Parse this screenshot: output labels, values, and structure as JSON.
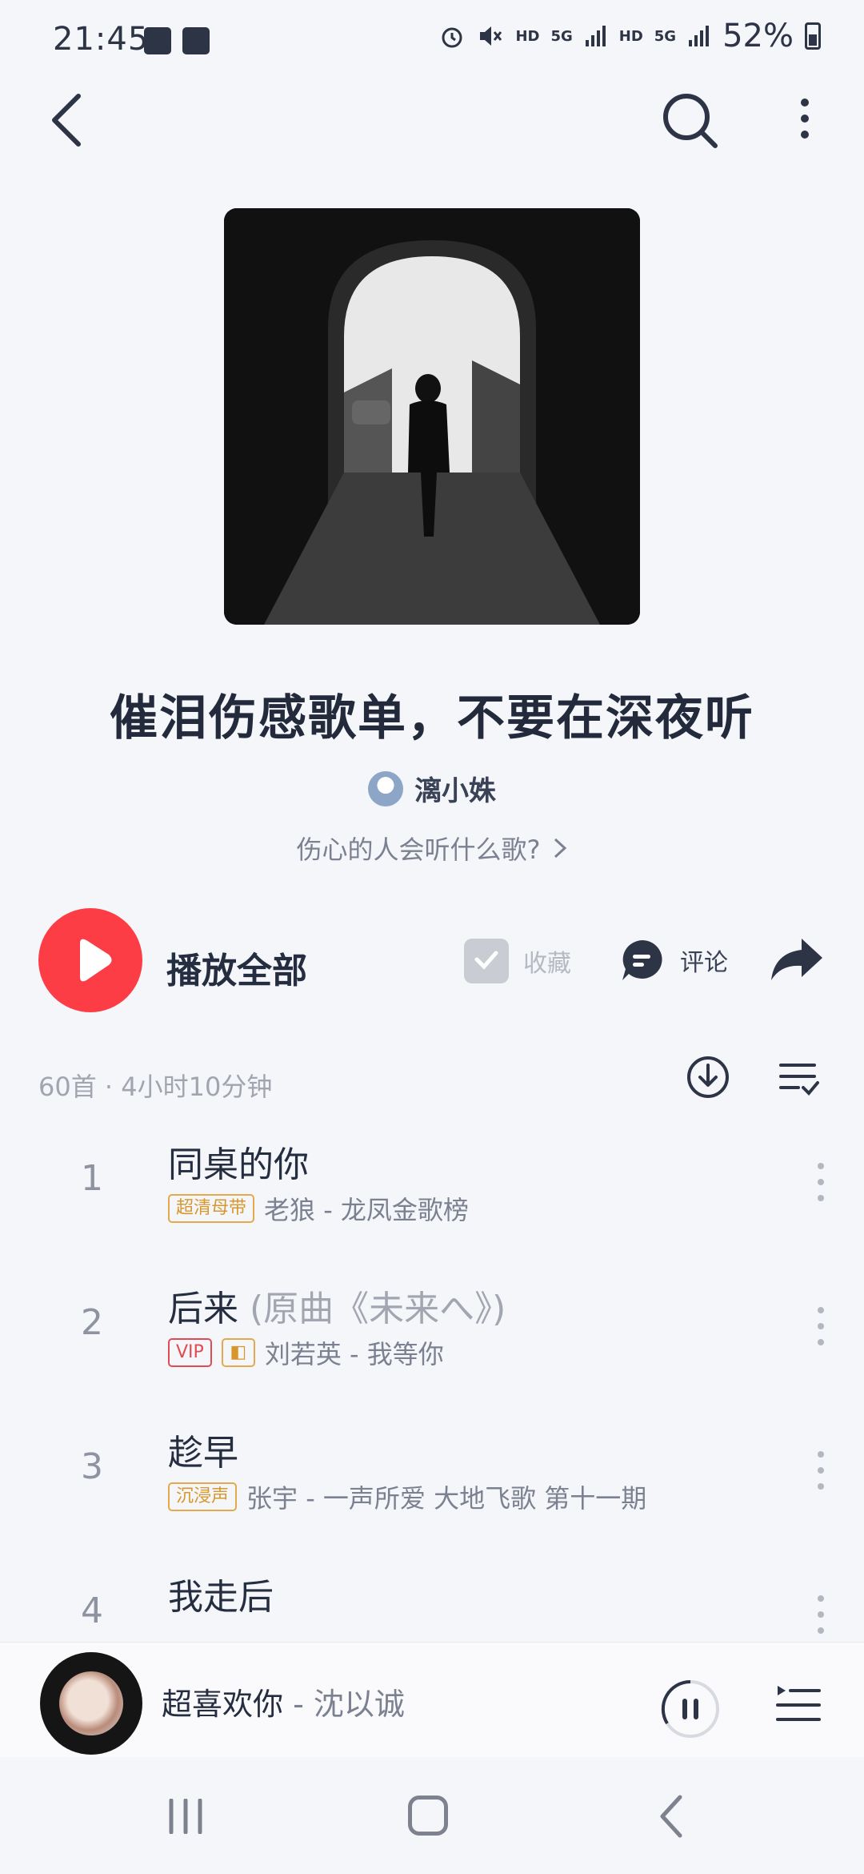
{
  "status_bar": {
    "time": "21:45",
    "network_labels": [
      "HD",
      "5G",
      "HD",
      "5G"
    ],
    "battery": "52%"
  },
  "nav": {
    "back_icon": "chevron-left-icon",
    "search_icon": "search-icon",
    "more_icon": "vertical-dots-icon"
  },
  "playlist": {
    "title": "催泪伤感歌单，不要在深夜听",
    "author": "漓小姝",
    "description": "伤心的人会听什么歌?",
    "meta": "60首 · 4小时10分钟"
  },
  "actions": {
    "play_all": "播放全部",
    "collect": "收藏",
    "comment": "评论"
  },
  "songs": [
    {
      "index": "1",
      "title": "同桌的你",
      "subtitle": "",
      "tags": [
        {
          "text": "超清母带",
          "type": "quality"
        }
      ],
      "artist": "老狼 - 龙凤金歌榜"
    },
    {
      "index": "2",
      "title": "后来",
      "subtitle": " (原曲《未来へ》)",
      "tags": [
        {
          "text": "VIP",
          "type": "vip"
        },
        {
          "text": "◧",
          "type": "dolby"
        }
      ],
      "artist": "刘若英 - 我等你"
    },
    {
      "index": "3",
      "title": "趁早",
      "subtitle": "",
      "tags": [
        {
          "text": "沉浸声",
          "type": "quality"
        }
      ],
      "artist": "张宇 - 一声所爱 大地飞歌 第十一期"
    },
    {
      "index": "4",
      "title": "我走后",
      "subtitle": "",
      "tags": [],
      "artist": ""
    }
  ],
  "mini_player": {
    "title": "超喜欢你",
    "artist": " - 沈以诚"
  },
  "colors": {
    "accent": "#fc3d45",
    "background": "#f5f6fa",
    "tag_gold": "#d8972c",
    "tag_vip": "#e14b51"
  }
}
